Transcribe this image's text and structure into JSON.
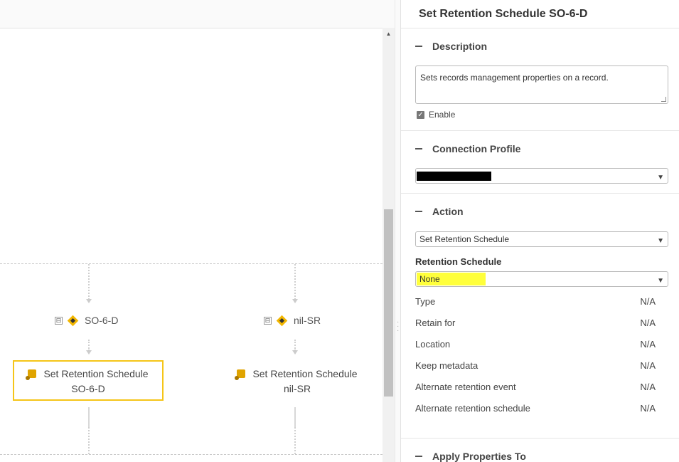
{
  "diagram": {
    "nodes": [
      {
        "label": "SO-6-D",
        "action_line1": "Set Retention Schedule",
        "action_line2": "SO-6-D",
        "selected": true
      },
      {
        "label": "nil-SR",
        "action_line1": "Set Retention Schedule",
        "action_line2": "nil-SR",
        "selected": false
      }
    ],
    "collapse_symbol": "⊟",
    "colors": {
      "selection_border": "#f5c518",
      "condition_icon": "#f2b600",
      "action_icon": "#e0a400"
    }
  },
  "panel": {
    "title": "Set Retention Schedule SO-6-D",
    "description": {
      "header": "Description",
      "value": "Sets records management properties on a record.",
      "enable_label": "Enable",
      "enabled": true
    },
    "connection_profile": {
      "header": "Connection Profile",
      "value": ""
    },
    "action": {
      "header": "Action",
      "value": "Set Retention Schedule",
      "retention_schedule_label": "Retention Schedule",
      "retention_schedule_value": "None",
      "highlight_color": "#ffff3b",
      "properties": [
        {
          "name": "Type",
          "value": "N/A"
        },
        {
          "name": "Retain for",
          "value": "N/A"
        },
        {
          "name": "Location",
          "value": "N/A"
        },
        {
          "name": "Keep metadata",
          "value": "N/A"
        },
        {
          "name": "Alternate retention event",
          "value": "N/A"
        },
        {
          "name": "Alternate retention schedule",
          "value": "N/A"
        }
      ]
    },
    "apply_properties": {
      "header": "Apply Properties To"
    }
  }
}
